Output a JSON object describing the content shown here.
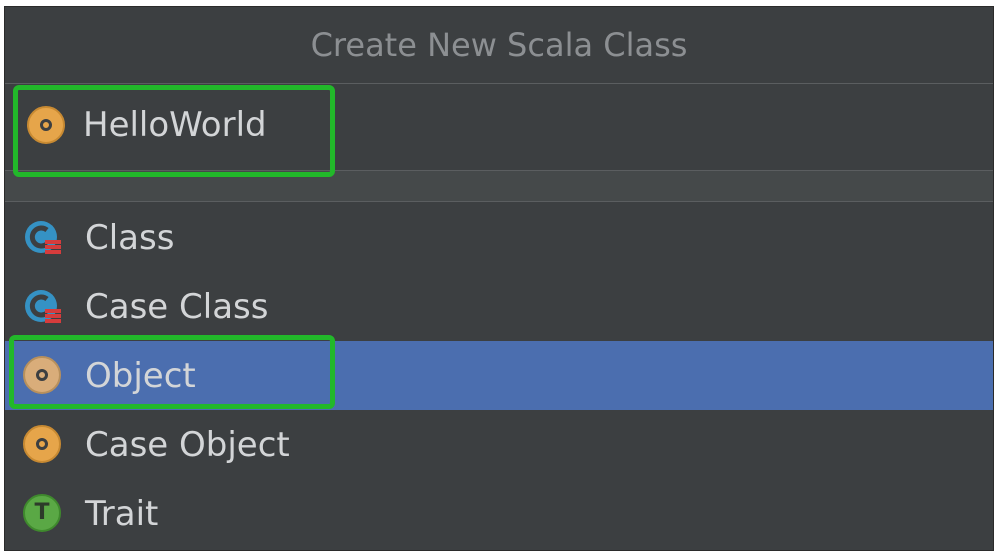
{
  "dialog": {
    "title": "Create New Scala Class"
  },
  "name_field": {
    "value": "HelloWorld",
    "icon": "object-icon"
  },
  "kinds": [
    {
      "label": "Class",
      "icon": "class-icon",
      "selected": false
    },
    {
      "label": "Case Class",
      "icon": "case-class-icon",
      "selected": false
    },
    {
      "label": "Object",
      "icon": "object-icon",
      "selected": true
    },
    {
      "label": "Case Object",
      "icon": "case-object-icon",
      "selected": false
    },
    {
      "label": "Trait",
      "icon": "trait-icon",
      "selected": false
    }
  ],
  "colors": {
    "background": "#3c3f41",
    "selection": "#4b6eaf",
    "highlight": "#22b82a",
    "object_icon": "#e6a54a",
    "class_icon": "#3592c4",
    "trait_icon": "#5aa845"
  },
  "trait_letter": "T"
}
